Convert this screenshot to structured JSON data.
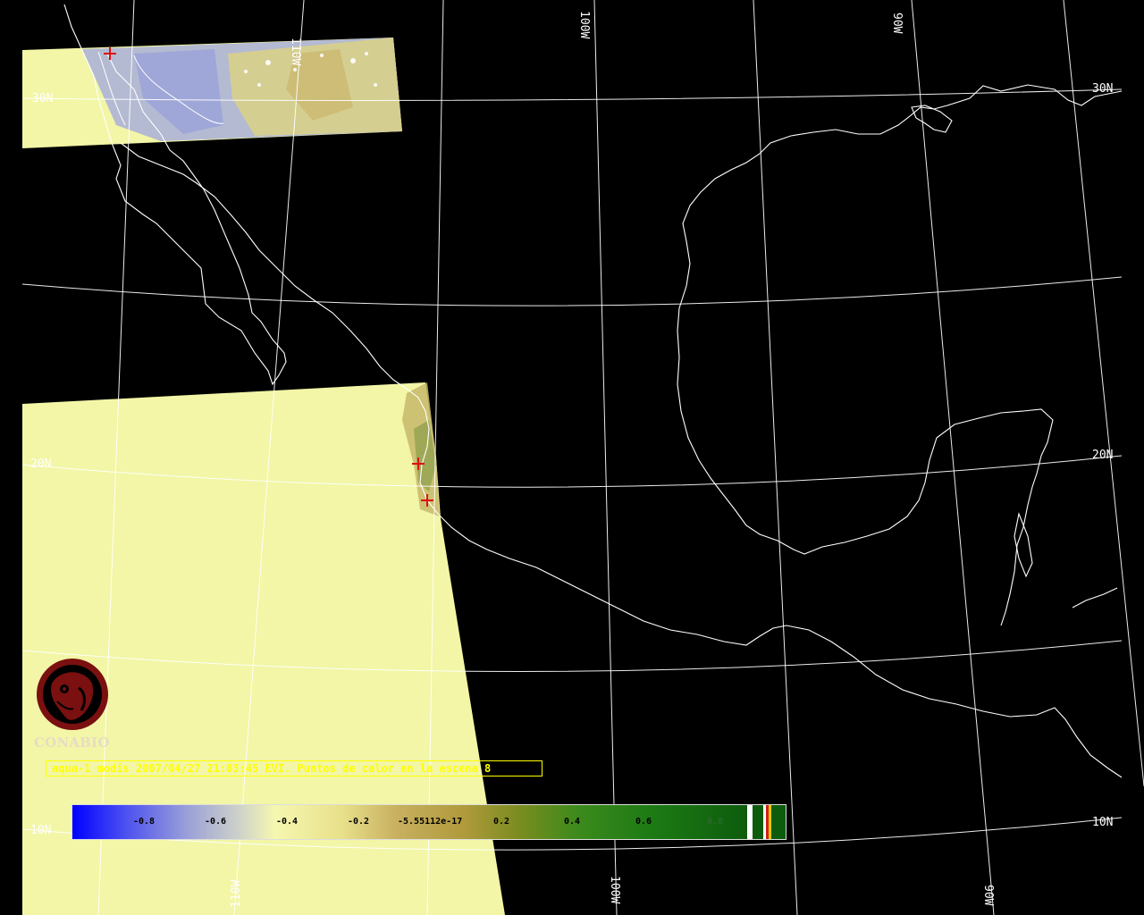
{
  "caption": "aqua-1 modis 2007/04/27 21:03:45 EVI. Puntos de calor en la escena 8",
  "logo": {
    "text": "CONABIO",
    "icon": "conabio-macaw-logo",
    "color": "#7a1010"
  },
  "colorbar": {
    "labels": [
      "-0.8",
      "-0.6",
      "-0.4",
      "-0.2",
      "-5.55112e-17",
      "0.2",
      "0.4",
      "0.6",
      "0.8"
    ],
    "colors": [
      "#0000ff",
      "#9aa0d8",
      "#f5f7b0",
      "#c8b060",
      "#3c8a1c",
      "#0d5c0d"
    ],
    "tail_colors": [
      "#ffffff",
      "#0d5c0d",
      "#ffffff",
      "#cc2222",
      "#e8c800",
      "#0d5c0d"
    ]
  },
  "graticule": {
    "lat_labels": [
      "30N",
      "20N",
      "10N",
      "30N",
      "20N",
      "10N"
    ],
    "lon_labels": [
      "110W",
      "100W",
      "90W",
      "110W",
      "100W",
      "90W"
    ]
  },
  "overlays": {
    "swath_color": "#f4f8a8",
    "fire_marker_color": "#dd1111",
    "fire_marker_icon": "red-cross-marker"
  }
}
